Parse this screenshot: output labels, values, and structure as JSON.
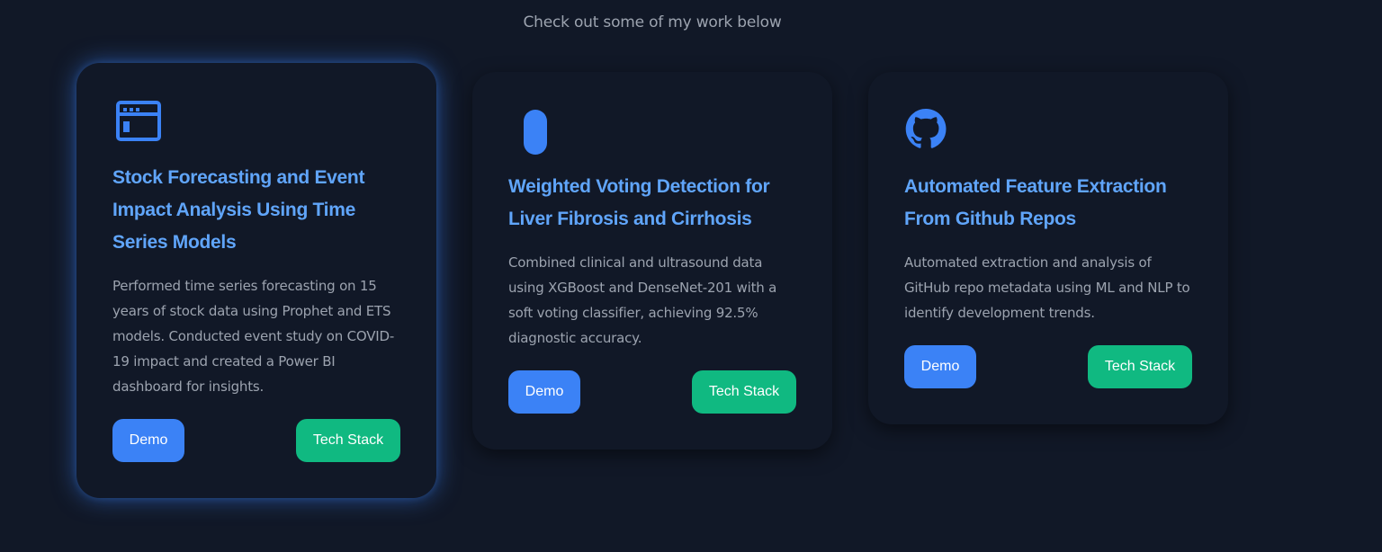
{
  "section": {
    "intro": "Check out some of my work below"
  },
  "projects": [
    {
      "icon": "browser-window-icon",
      "title": "Stock Forecasting and Event Impact Analysis Using Time Series Models",
      "description": "Performed time series forecasting on 15 years of stock data using Prophet and ETS models. Conducted event study on COVID-19 impact and created a Power BI dashboard for insights.",
      "demo_label": "Demo",
      "tech_label": "Tech Stack"
    },
    {
      "icon": "capsule-icon",
      "title": "Weighted Voting Detection for Liver Fibrosis and Cirrhosis",
      "description": "Combined clinical and ultrasound data using XGBoost and DenseNet-201 with a soft voting classifier, achieving 92.5% diagnostic accuracy.",
      "demo_label": "Demo",
      "tech_label": "Tech Stack"
    },
    {
      "icon": "github-icon",
      "title": "Automated Feature Extraction From Github Repos",
      "description": "Automated extraction and analysis of GitHub repo metadata using ML and NLP to identify development trends.",
      "demo_label": "Demo",
      "tech_label": "Tech Stack"
    }
  ],
  "colors": {
    "background": "#111827",
    "title": "#60a5fa",
    "icon": "#3b82f6",
    "text": "#9ca3af",
    "demo_button": "#3b82f6",
    "tech_button": "#10b981",
    "glow": "#3b82f6"
  }
}
